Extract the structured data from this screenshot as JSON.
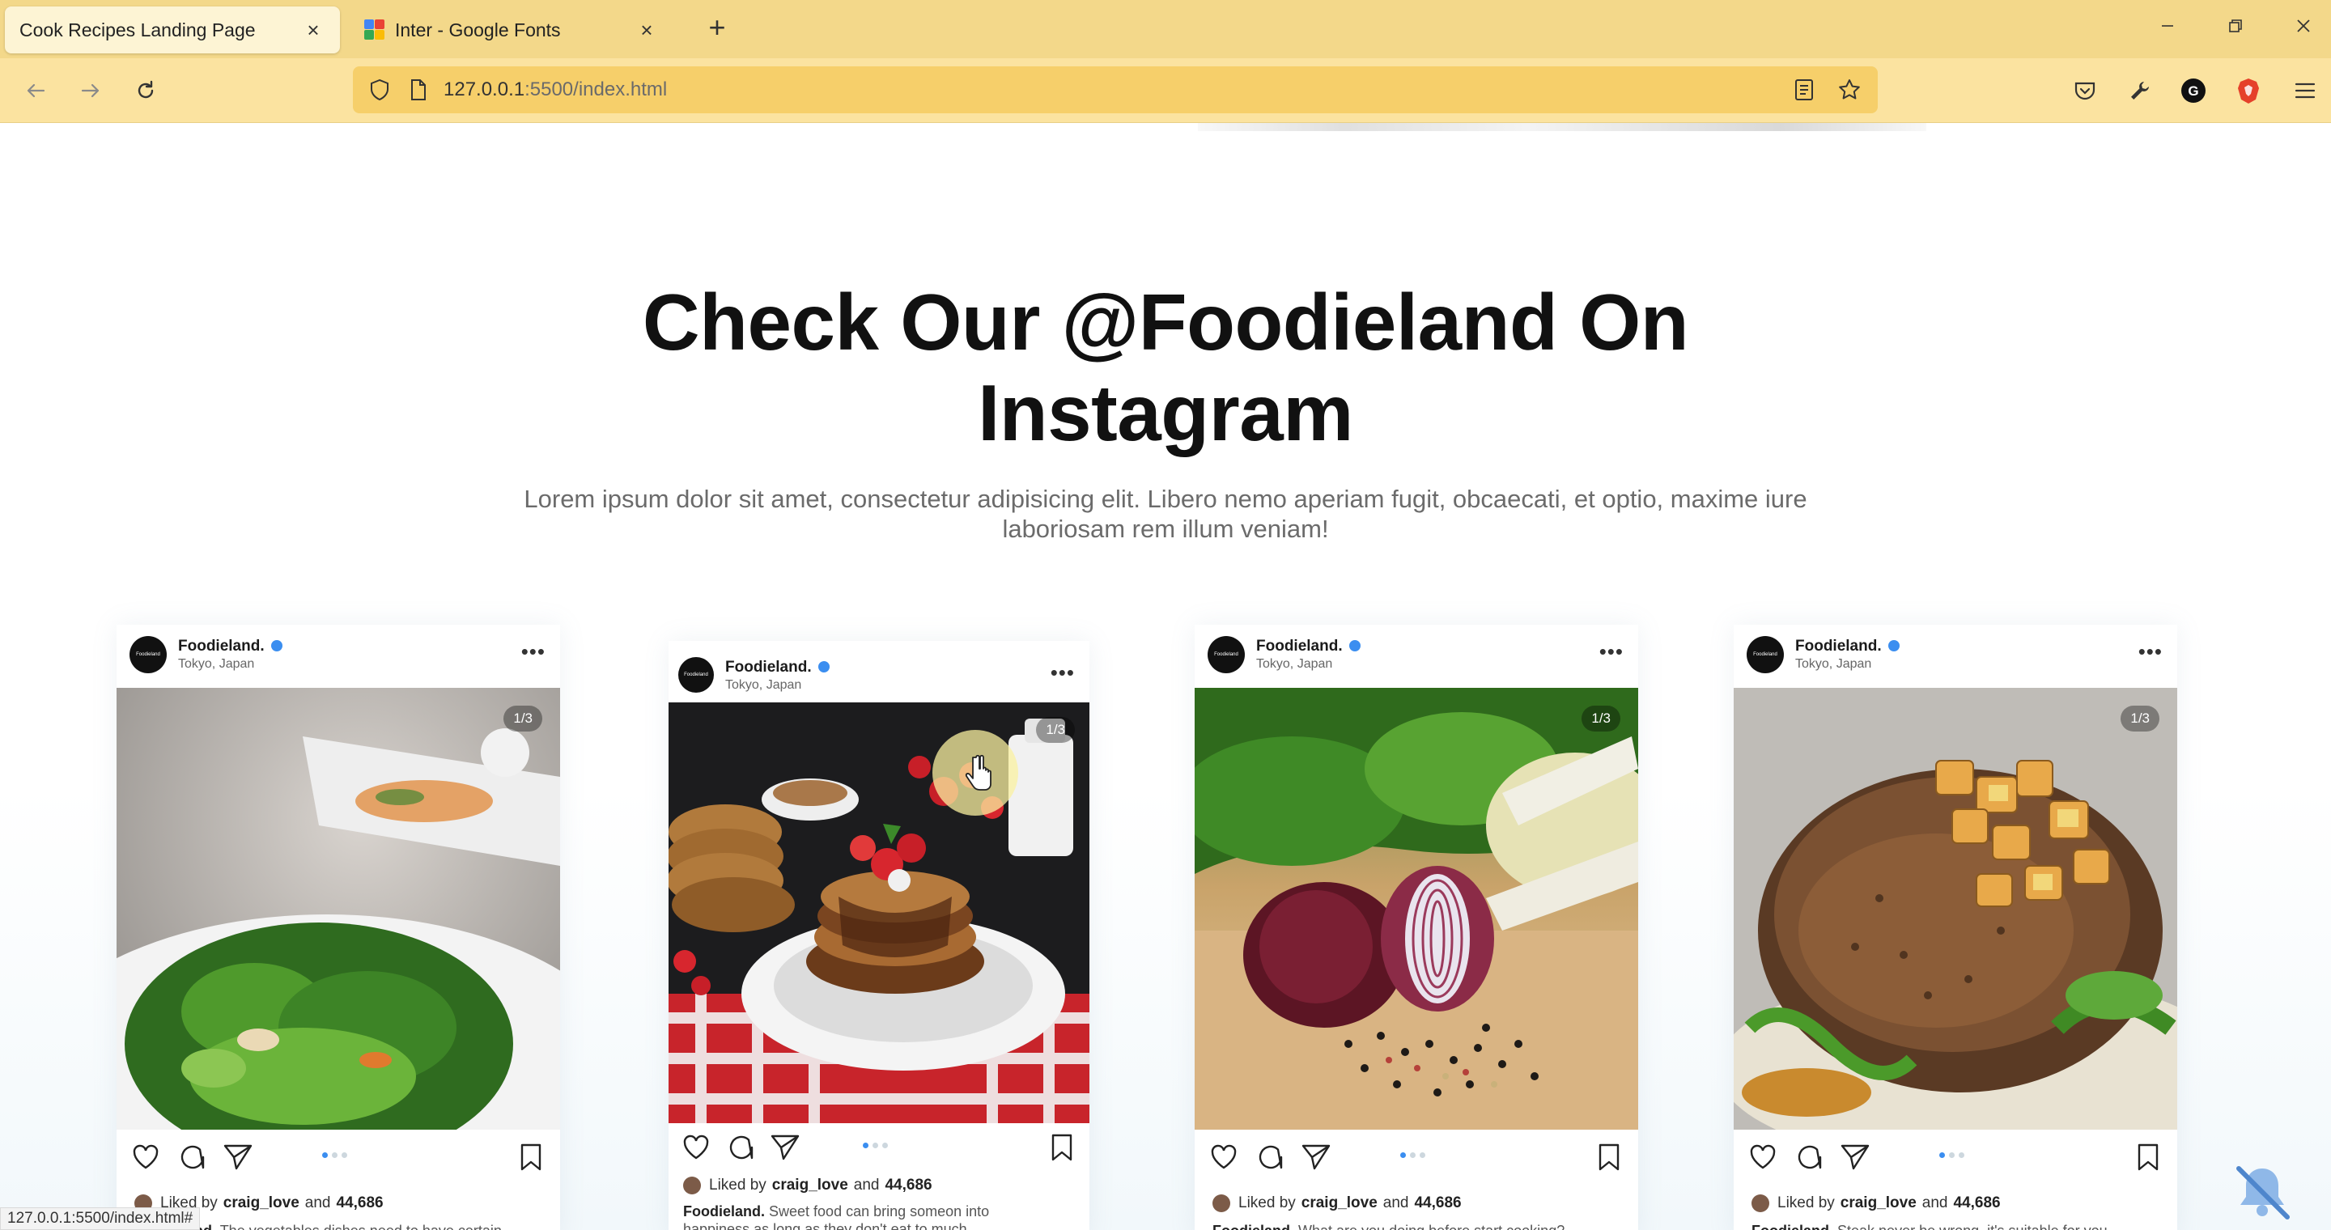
{
  "browser": {
    "tabs": [
      {
        "title": "Cook Recipes Landing Page",
        "active": true
      },
      {
        "title": "Inter - Google Fonts",
        "active": false
      }
    ],
    "url": {
      "host": "127.0.0.1",
      "path": ":5500/index.html"
    },
    "icons": [
      "back-arrow-icon",
      "forward-arrow-icon",
      "reload-icon",
      "shield-icon",
      "page-icon",
      "reader-view-icon",
      "star-icon",
      "pocket-icon",
      "wrench-icon",
      "grammarly-icon",
      "brave-icon",
      "menu-icon"
    ],
    "accent_color": "#f3d88a"
  },
  "section": {
    "title_line1": "Check Our @Foodieland On",
    "title_line2": "Instagram",
    "subtitle_line1": "Lorem ipsum dolor sit amet, consectetur adipisicing elit. Libero nemo aperiam fugit, obcaecati, et optio, maxime iure",
    "subtitle_line2": "laboriosam rem illum veniam!"
  },
  "posts": [
    {
      "account": "Foodieland.",
      "location": "Tokyo, Japan",
      "counter": "1/3",
      "liked_by_prefix": "Liked by",
      "liked_user": "craig_love",
      "liked_and": "and",
      "liked_count": "44,686",
      "caption_author": "Foodieland.",
      "caption": "The vegetables dishes need to have certain"
    },
    {
      "account": "Foodieland.",
      "location": "Tokyo, Japan",
      "counter": "1/3",
      "liked_by_prefix": "Liked by",
      "liked_user": "craig_love",
      "liked_and": "and",
      "liked_count": "44,686",
      "caption_author": "Foodieland.",
      "caption": "Sweet food can bring someon into",
      "caption_line2": "happiness as long as they don't eat to much"
    },
    {
      "account": "Foodieland.",
      "location": "Tokyo, Japan",
      "counter": "1/3",
      "liked_by_prefix": "Liked by",
      "liked_user": "craig_love",
      "liked_and": "and",
      "liked_count": "44,686",
      "caption_author": "Foodieland.",
      "caption": "What are you doing before start cooking?"
    },
    {
      "account": "Foodieland.",
      "location": "Tokyo, Japan",
      "counter": "1/3",
      "liked_by_prefix": "Liked by",
      "liked_user": "craig_love",
      "liked_and": "and",
      "liked_count": "44,686",
      "caption_author": "Foodieland.",
      "caption": "Steak never be wrong, it's suitable for you"
    }
  ],
  "status_bar": "127.0.0.1:5500/index.html#"
}
